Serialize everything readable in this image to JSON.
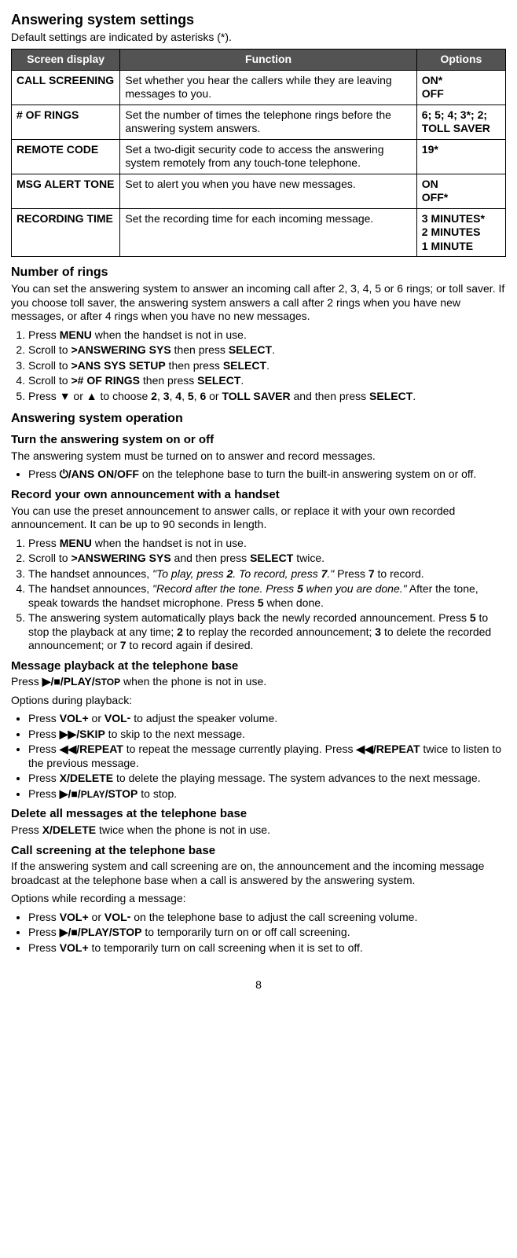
{
  "title": "Answering system settings",
  "intro": "Default settings are indicated by asterisks (*).",
  "table": {
    "headers": [
      "Screen display",
      "Function",
      "Options"
    ],
    "rows": [
      {
        "display": "CALL SCREENING",
        "function": "Set whether you hear the callers while they are leaving messages to you.",
        "options": "ON*\nOFF"
      },
      {
        "display": "# OF RINGS",
        "function": "Set the number of times the telephone rings before the answering system answers.",
        "options": "6; 5; 4; 3*; 2;\nTOLL SAVER"
      },
      {
        "display": "REMOTE CODE",
        "function": "Set a two-digit security code to access the answering system remotely from any touch-tone telephone.",
        "options": "19*"
      },
      {
        "display": "MSG ALERT TONE",
        "function": "Set to alert you when you have new messages.",
        "options": "ON\nOFF*"
      },
      {
        "display": "RECORDING TIME",
        "function": "Set the recording time for each incoming message.",
        "options": "3 MINUTES*\n2 MINUTES\n1 MINUTE"
      }
    ]
  },
  "numRings": {
    "heading": "Number of rings",
    "intro": "You can set the answering system to answer an incoming call after 2, 3, 4, 5 or 6 rings; or toll saver. If you choose toll saver, the answering system answers a call after 2 rings when you have new messages, or after 4 rings when you have no new messages.",
    "steps": {
      "s1a": "Press ",
      "s1b": "MENU",
      "s1c": " when the handset is not in use.",
      "s2a": "Scroll to ",
      "s2b": ">ANSWERING SYS",
      "s2c": " then press ",
      "s2d": "SELECT",
      "s2e": ".",
      "s3a": "Scroll to ",
      "s3b": ">ANS SYS SETUP",
      "s3c": " then press ",
      "s3d": "SELECT",
      "s3e": ".",
      "s4a": "Scroll to ",
      "s4b": "># OF RINGS",
      "s4c": " then press ",
      "s4d": "SELECT",
      "s4e": ".",
      "s5a": "Press ",
      "s5b": "▼",
      "s5c": " or ",
      "s5d": "▲",
      "s5e": " to choose ",
      "s5f": "2",
      "s5g": ", ",
      "s5h": "3",
      "s5i": ", ",
      "s5j": "4",
      "s5k": ", ",
      "s5l": "5",
      "s5m": ", ",
      "s5n": "6",
      "s5o": " or ",
      "s5p": "TOLL SAVER",
      "s5q": " and then press ",
      "s5r": "SELECT",
      "s5s": "."
    }
  },
  "operation": {
    "heading": "Answering system operation",
    "turnOnOff": {
      "heading": "Turn the answering system on or off",
      "intro": "The answering system must be turned on to answer and record messages.",
      "b1a": "Press ",
      "b1b": "⏻/ANS ON/OFF",
      "b1c": " on the telephone base to turn the built-in answering system on or off."
    },
    "record": {
      "heading": "Record your own announcement with a handset",
      "intro": "You can use the preset announcement to answer calls, or replace it with your own recorded announcement. It can be up to 90 seconds in length.",
      "s1a": "Press ",
      "s1b": "MENU",
      "s1c": " when the handset is not in use.",
      "s2a": "Scroll to ",
      "s2b": ">ANSWERING SYS",
      "s2c": " and then press ",
      "s2d": "SELECT",
      "s2e": " twice.",
      "s3a": "The handset announces, ",
      "s3b": "\"To play, press ",
      "s3c": "2",
      "s3d": ". To record, press ",
      "s3e": "7",
      "s3f": ".\"",
      "s3g": " Press ",
      "s3h": "7",
      "s3i": " to record.",
      "s4a": "The handset announces, ",
      "s4b": "\"Record after the tone. Press ",
      "s4c": "5",
      "s4d": " when you are done.\"",
      "s4e": " After the tone, speak towards the handset microphone. Press ",
      "s4f": "5",
      "s4g": " when done.",
      "s5a": "The answering system automatically plays back the newly recorded announcement. Press ",
      "s5b": "5",
      "s5c": " to stop the playback at any time; ",
      "s5d": "2",
      "s5e": " to replay the recorded announcement; ",
      "s5f": "3",
      "s5g": " to delete the recorded announcement; or ",
      "s5h": "7",
      "s5i": " to record again if desired."
    },
    "playback": {
      "heading": "Message playback at the telephone base",
      "introA": "Press ",
      "introB": "▶/■/PLAY/",
      "introC": "STOP",
      "introD": " when the phone is not in use.",
      "optionsLabel": "Options during playback:",
      "b1a": "Press ",
      "b1b": "VOL+",
      "b1c": " or ",
      "b1d": "VOL",
      "b1e": " to adjust the speaker volume.",
      "b2a": "Press ",
      "b2b": "▶▶/SKIP",
      "b2c": " to skip to the next message.",
      "b3a": "Press ",
      "b3b": "◀◀/REPEAT",
      "b3c": " to repeat the message currently playing. Press ",
      "b3d": "◀◀/REPEAT",
      "b3e": " twice to listen to the previous message.",
      "b4a": "Press ",
      "b4b": "X/DELETE",
      "b4c": " to delete the playing message. The system advances to the next message.",
      "b5a": "Press ",
      "b5b": "▶/■/",
      "b5c": "PLAY",
      "b5d": "/STOP",
      "b5e": " to stop."
    },
    "deleteAll": {
      "heading": "Delete all messages at the telephone base",
      "pA": "Press ",
      "pB": "X/DELETE",
      "pC": " twice when the phone is not in use."
    },
    "callScreen": {
      "heading": "Call screening at the telephone base",
      "intro": "If the answering system and call screening are on, the announcement and the incoming message broadcast at the telephone base when a call is answered by the answering system.",
      "optionsLabel": "Options while recording a message:",
      "b1a": "Press ",
      "b1b": "VOL+",
      "b1c": " or ",
      "b1d": "VOL",
      "b1e": " on the telephone base to adjust the call screening volume.",
      "b2a": "Press ",
      "b2b": "▶/■/PLAY/STOP",
      "b2c": " to temporarily turn on or off call screening.",
      "b3a": "Press ",
      "b3b": "VOL+",
      "b3c": " to temporarily turn on call screening when it is set to off."
    }
  },
  "pageNumber": "8"
}
